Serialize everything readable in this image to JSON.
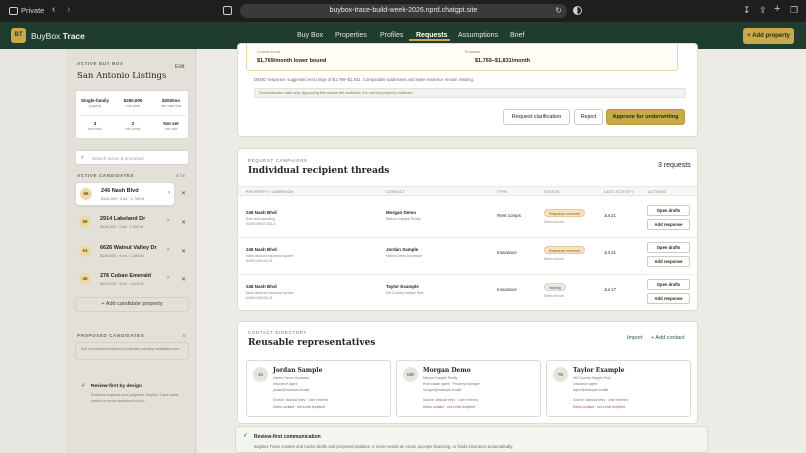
{
  "browser": {
    "private_label": "Private",
    "url": "buybox-trace-build-week-2026.nprd.chatgpt.site"
  },
  "header": {
    "logo_text": "BT",
    "brand_first": "BuyBox",
    "brand_second": "Trace",
    "nav": [
      "Buy Box",
      "Properties",
      "Profiles",
      "Requests",
      "Assumptions",
      "Brief"
    ],
    "active_nav": "Requests",
    "add_property_label": "+ Add property"
  },
  "sidebar": {
    "active_buy_box_label": "ACTIVE BUY BOX",
    "edit_label": "Edit",
    "title": "San Antonio Listings",
    "stats": [
      {
        "value": "Single-family",
        "label": "property"
      },
      {
        "value": "$260,000",
        "label": "max price"
      },
      {
        "value": "$200/mo",
        "label": "min cash flow"
      },
      {
        "value": "3",
        "label": "min beds"
      },
      {
        "value": "2",
        "label": "min baths"
      },
      {
        "value": "Not set",
        "label": "min size"
      }
    ],
    "search_placeholder": "Search active & proposed",
    "active_candidates_label": "ACTIVE CANDIDATES",
    "active_candidates_count": "4 / 5",
    "candidates": [
      {
        "score": "56",
        "name": "246 Nash Blvd",
        "meta": "$110,000 · 3 bd · 1,796 sf"
      },
      {
        "score": "58",
        "name": "2914 Lakeland Dr",
        "meta": "$115,000 · 4 bd · 1,000 sf"
      },
      {
        "score": "54",
        "name": "6626 Walnut Valley Dr",
        "meta": "$146,000 · 4 bd · 1,186 sf"
      },
      {
        "score": "46",
        "name": "276 Cuban Emerald",
        "meta": "$229,000 · 3 bd · 1,023 sf"
      }
    ],
    "add_candidate_label": "+ Add candidate property",
    "proposed_label": "PROPOSED CANDIDATES",
    "proposed_count": "0",
    "proposed_text": "Run one authorized search to populate matching candidates here.",
    "review_title": "Review-first by design",
    "review_body": "Evidence supports your judgment. BuyBox Trace never makes or sends decisions for you."
  },
  "main": {
    "rent_bounds": {
      "current_label": "Current record",
      "current_value": "$1,769/month lower bound",
      "proposed_label": "Proposed",
      "proposed_value": "$1,769–$1,831/month"
    },
    "demo_note": "DEMO response: suggested rent range of $1,769–$1,831. Comparable addresses and lease evidence remain missing.",
    "warn_note": "Demonstration data only. Approving this shows the workflow; it is not real property evidence.",
    "actions": {
      "request_clarification": "Request clarification",
      "reject": "Reject",
      "approve": "Approve for underwriting"
    },
    "campaigns": {
      "eyebrow": "REQUEST CAMPAIGNS",
      "title": "Individual recipient threads",
      "count_label": "3 requests",
      "columns": [
        "PROPERTY / CAMPAIGN",
        "CONTACT",
        "TYPE",
        "STATUS",
        "LAST ACTIVITY",
        "ACTIONS"
      ],
      "rows": [
        {
          "property": "246 Nash Blvd",
          "sub1": "Rent and operating",
          "sub2": "NASH-RENT-001-A",
          "contact": "Morgan Demo",
          "contact_sub": "Mission Sample Realty",
          "type": "Rent comps",
          "status": "Response received",
          "status_sub": "Demo record",
          "date": "Jul 21",
          "btn1": "Open drafts",
          "btn2": "Add response"
        },
        {
          "property": "246 Nash Blvd",
          "sub1": "Nash landlord insurance quotes",
          "sub2": "NASH-INS-001-B",
          "contact": "Jordan Sample",
          "contact_sub": "Harbor Demo Insurance",
          "type": "Insurance",
          "status": "Response received",
          "status_sub": "Demo record",
          "date": "Jul 21",
          "btn1": "Open drafts",
          "btn2": "Add response"
        },
        {
          "property": "246 Nash Blvd",
          "sub1": "Nash landlord insurance quotes",
          "sub2": "NASH-INS-001-B",
          "contact": "Taylor Example",
          "contact_sub": "Hill Country Sample Risk",
          "type": "Insurance",
          "status": "Waiting",
          "status_sub": "Demo record",
          "date": "Jul 17",
          "btn1": "Open drafts",
          "btn2": "Add response"
        }
      ]
    },
    "directory": {
      "eyebrow": "CONTACT DIRECTORY",
      "title": "Reusable representatives",
      "import_label": "Import",
      "add_contact_label": "+ Add contact",
      "contacts": [
        {
          "initials": "JS",
          "name": "Jordan Sample",
          "company": "Harbor Demo Insurance",
          "role": "Insurance agent",
          "email": "jordan@example.invalid",
          "source": "Source: Manual entry · User entered",
          "flag": "Demo contact · not a real recipient"
        },
        {
          "initials": "MD",
          "name": "Morgan Demo",
          "company": "Mission Sample Realty",
          "role": "Real estate agent · Property manager",
          "email": "morgan@example.invalid",
          "source": "Source: Manual entry · User entered",
          "flag": "Demo contact · not a real recipient"
        },
        {
          "initials": "TE",
          "name": "Taylor Example",
          "company": "Hill Country Sample Risk",
          "role": "Insurance agent",
          "email": "taylor@example.invalid",
          "source": "Source: Manual entry · User entered",
          "flag": "Demo contact · not a real recipient"
        }
      ]
    },
    "review_first": {
      "title": "Review-first communication",
      "body": "BuyBox Trace creates and tracks drafts and proposed updates. It never sends an email, accepts financing, or binds insurance automatically."
    }
  }
}
